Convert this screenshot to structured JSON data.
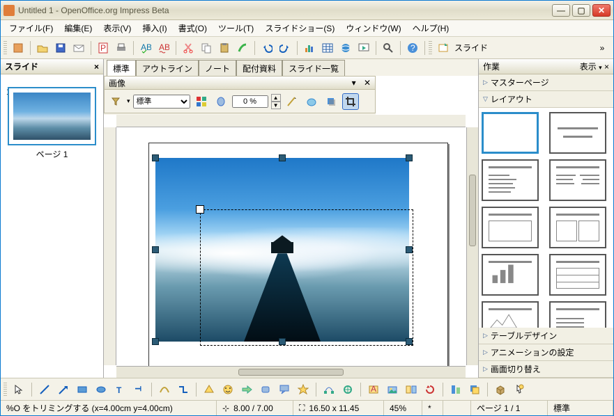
{
  "window": {
    "title": "Untitled 1 - OpenOffice.org Impress Beta"
  },
  "menu": {
    "file": "ファイル(F)",
    "edit": "編集(E)",
    "view": "表示(V)",
    "insert": "挿入(I)",
    "format": "書式(O)",
    "tools": "ツール(T)",
    "slideshow": "スライドショー(S)",
    "window": "ウィンドウ(W)",
    "help": "ヘルプ(H)"
  },
  "sidetoolbar": {
    "slide_label": "スライド"
  },
  "slides": {
    "title": "スライド",
    "page_label": "ページ 1",
    "page_num": "1"
  },
  "tabs": {
    "normal": "標準",
    "outline": "アウトライン",
    "notes": "ノート",
    "handout": "配付資料",
    "sorter": "スライド一覧"
  },
  "imagebar": {
    "title": "画像",
    "filter_default": "標準",
    "transparency": "0 %",
    "pin": "⬥",
    "close": "✕"
  },
  "taskpane": {
    "title": "作業",
    "view": "表示",
    "sections": {
      "master": "マスターページ",
      "layout": "レイアウト",
      "table": "テーブルデザイン",
      "anim": "アニメーションの設定",
      "trans": "画面切り替え"
    }
  },
  "status": {
    "msg": "%O をトリミングする (x=4.00cm y=4.00cm)",
    "pos": "8.00 / 7.00",
    "size": "16.50 x 11.45",
    "zoom": "45%",
    "star": "*",
    "page": "ページ 1 / 1",
    "mode": "標準"
  }
}
